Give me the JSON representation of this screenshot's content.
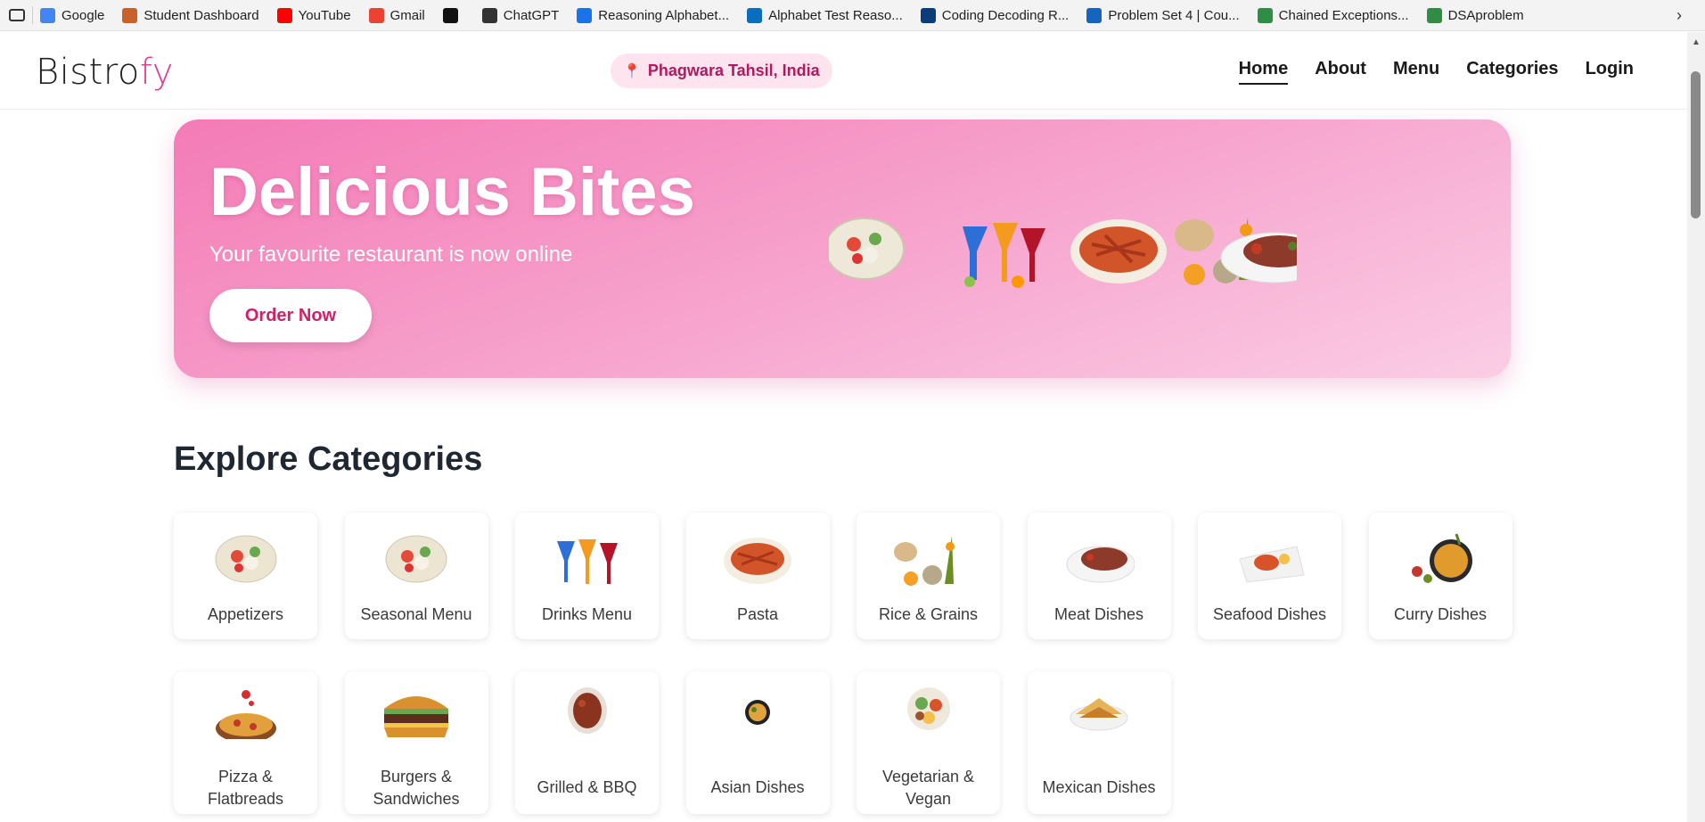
{
  "bookmarks": {
    "items": [
      {
        "label": "Google",
        "icon": "google-icon",
        "color": "#4285f4"
      },
      {
        "label": "Student Dashboard",
        "icon": "basketball-icon",
        "color": "#c9622a"
      },
      {
        "label": "YouTube",
        "icon": "youtube-icon",
        "color": "#ff0000"
      },
      {
        "label": "Gmail",
        "icon": "gmail-icon",
        "color": "#ea4335"
      },
      {
        "label": "",
        "icon": "dots-app-icon",
        "color": "#111111"
      },
      {
        "label": "ChatGPT",
        "icon": "chatgpt-icon",
        "color": "#333333"
      },
      {
        "label": "Reasoning Alphabet...",
        "icon": "arrow-circle-icon",
        "color": "#1a73e8"
      },
      {
        "label": "Alphabet Test Reaso...",
        "icon": "bookmark-flag-icon",
        "color": "#0a6ebd"
      },
      {
        "label": "Coding Decoding R...",
        "icon": "bookmark-flag-icon",
        "color": "#0a3d7a"
      },
      {
        "label": "Problem Set 4 | Cou...",
        "icon": "c-logo-icon",
        "color": "#1565c0"
      },
      {
        "label": "Chained Exceptions...",
        "icon": "gfg-icon",
        "color": "#2f8d46"
      },
      {
        "label": "DSAproblem",
        "icon": "gfg-icon",
        "color": "#2f8d46"
      }
    ]
  },
  "header": {
    "logo_main": "Bistro",
    "logo_accent": "fy",
    "location": "Phagwara Tahsil, India",
    "nav": [
      {
        "label": "Home",
        "active": true
      },
      {
        "label": "About",
        "active": false
      },
      {
        "label": "Menu",
        "active": false
      },
      {
        "label": "Categories",
        "active": false
      },
      {
        "label": "Login",
        "active": false
      }
    ]
  },
  "hero": {
    "title": "Delicious Bites",
    "subtitle": "Your favourite restaurant is now online",
    "cta": "Order Now",
    "gallery": [
      "salad-plate",
      "cocktail-glasses",
      "pasta-bowl",
      "rice-spices",
      "steak-plate"
    ]
  },
  "categories": {
    "title": "Explore Categories",
    "items": [
      {
        "label": "Appetizers",
        "art": "salad-plate"
      },
      {
        "label": "Seasonal Menu",
        "art": "salad-plate"
      },
      {
        "label": "Drinks Menu",
        "art": "cocktail-glasses"
      },
      {
        "label": "Pasta",
        "art": "pasta-bowl"
      },
      {
        "label": "Rice & Grains",
        "art": "rice-spices"
      },
      {
        "label": "Meat Dishes",
        "art": "steak-plate"
      },
      {
        "label": "Seafood Dishes",
        "art": "seafood-plate"
      },
      {
        "label": "Curry Dishes",
        "art": "curry-pan"
      },
      {
        "label": "Pizza & Flatbreads",
        "art": "pizza"
      },
      {
        "label": "Burgers & Sandwiches",
        "art": "burger"
      },
      {
        "label": "Grilled & BBQ",
        "art": "grilled-meat"
      },
      {
        "label": "Asian Dishes",
        "art": "asian-bowl"
      },
      {
        "label": "Vegetarian & Vegan",
        "art": "veg-bowl"
      },
      {
        "label": "Mexican Dishes",
        "art": "quesadilla"
      }
    ]
  },
  "colors": {
    "accent": "#e23d94",
    "hero_start": "#f47bb6",
    "hero_end": "#fbcde5",
    "cta_text": "#d21f6a"
  }
}
